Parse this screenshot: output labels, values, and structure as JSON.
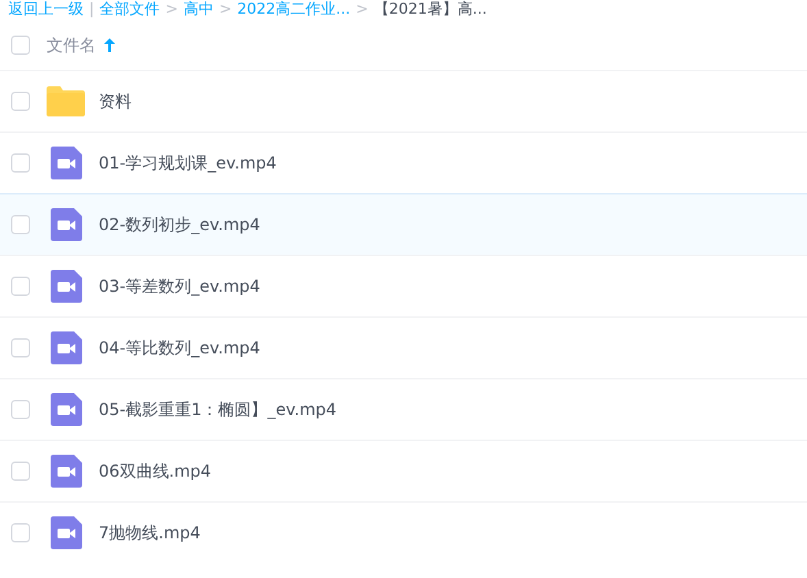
{
  "breadcrumb": [
    {
      "label": "返回上一级",
      "kind": "link"
    },
    {
      "label": "|",
      "kind": "separator"
    },
    {
      "label": "全部文件",
      "kind": "link"
    },
    {
      "label": ">",
      "kind": "separator"
    },
    {
      "label": "高中",
      "kind": "link"
    },
    {
      "label": ">",
      "kind": "separator"
    },
    {
      "label": "2022高二作业...",
      "kind": "link"
    },
    {
      "label": ">",
      "kind": "separator"
    },
    {
      "label": "【2021暑】高...",
      "kind": "current"
    }
  ],
  "header": {
    "checked": false,
    "column": "文件名",
    "sort_ascending": true
  },
  "files": [
    {
      "name": "资料",
      "kind": "folder",
      "checked": false,
      "highlighted": false
    },
    {
      "name": "01-学习规划课_ev.mp4",
      "kind": "video",
      "checked": false,
      "highlighted": false
    },
    {
      "name": "02-数列初步_ev.mp4",
      "kind": "video",
      "checked": false,
      "highlighted": true
    },
    {
      "name": "03-等差数列_ev.mp4",
      "kind": "video",
      "checked": false,
      "highlighted": false
    },
    {
      "name": "04-等比数列_ev.mp4",
      "kind": "video",
      "checked": false,
      "highlighted": false
    },
    {
      "name": "05-截影重重1：椭圆】_ev.mp4",
      "kind": "video",
      "checked": false,
      "highlighted": false
    },
    {
      "name": "06双曲线.mp4",
      "kind": "video",
      "checked": false,
      "highlighted": false
    },
    {
      "name": "7抛物线.mp4",
      "kind": "video",
      "checked": false,
      "highlighted": false
    }
  ]
}
